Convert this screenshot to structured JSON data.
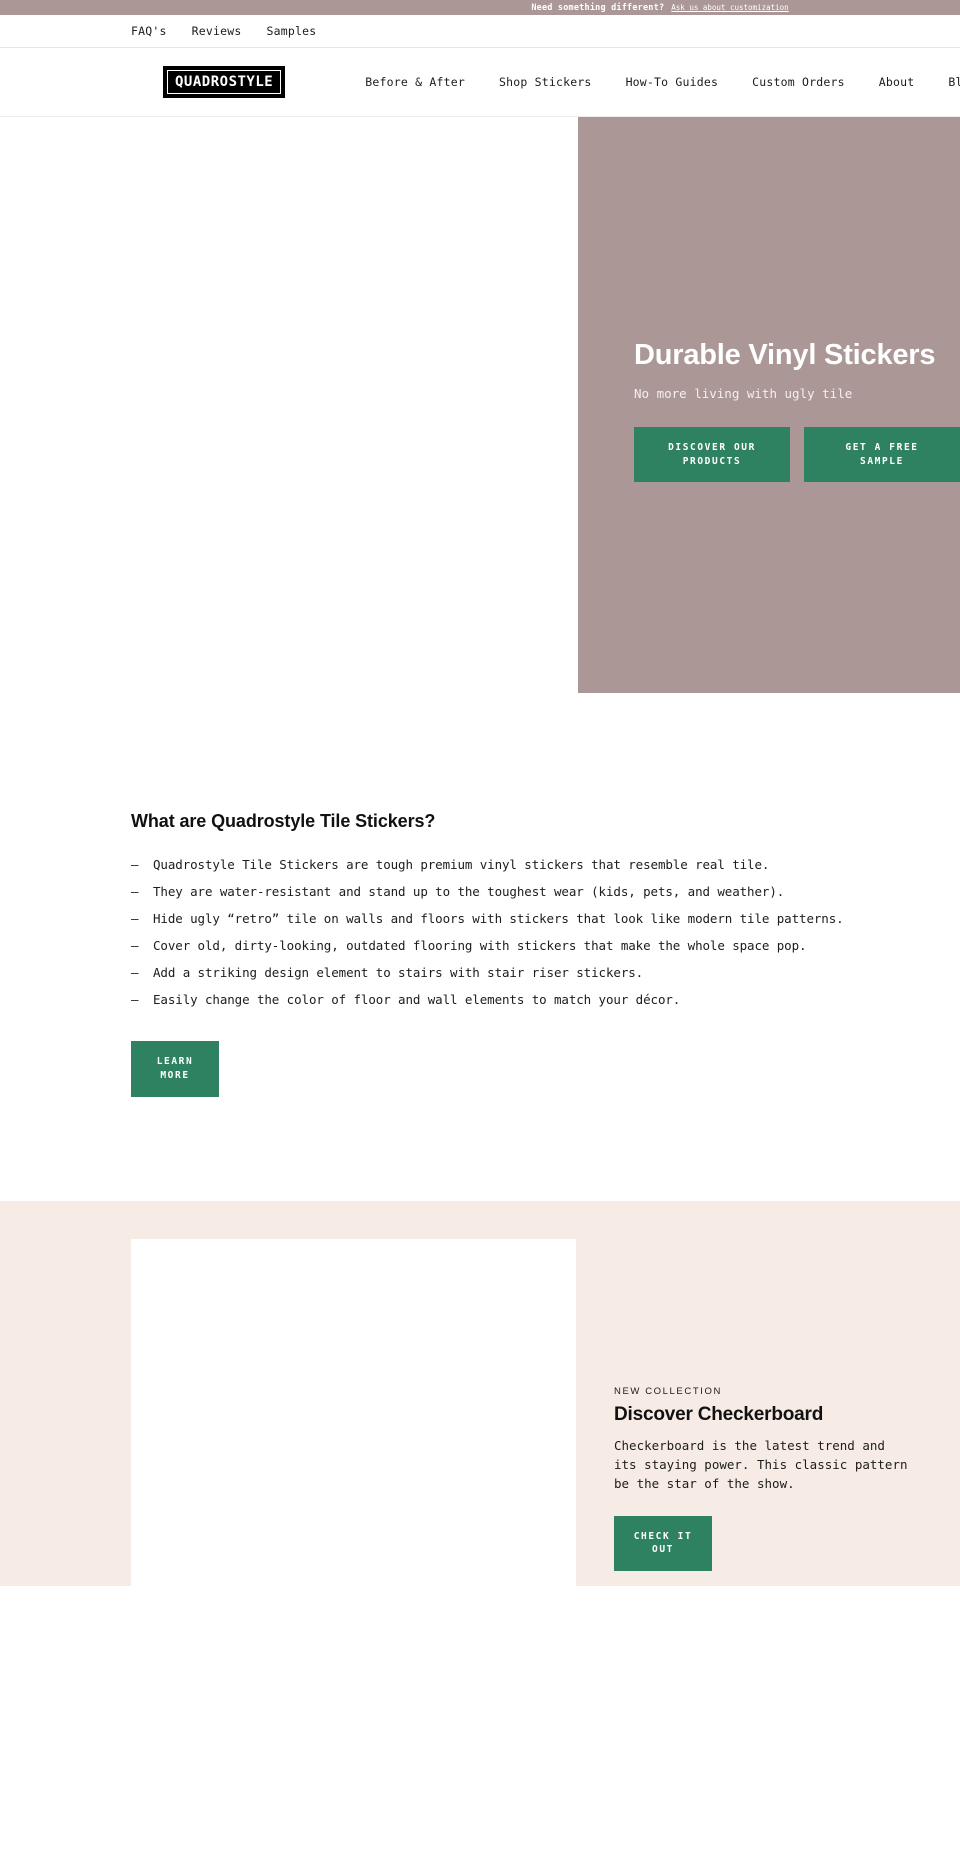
{
  "announcement": {
    "text": "Need something different?",
    "link_label": "Ask us about customization"
  },
  "utility_nav": {
    "items": [
      {
        "label": "FAQ's"
      },
      {
        "label": "Reviews"
      },
      {
        "label": "Samples"
      }
    ]
  },
  "header": {
    "logo_text": "QUADROSTYLE",
    "nav": [
      {
        "label": "Before & After"
      },
      {
        "label": "Shop Stickers"
      },
      {
        "label": "How-To Guides"
      },
      {
        "label": "Custom Orders"
      },
      {
        "label": "About"
      },
      {
        "label": "Blog"
      }
    ]
  },
  "hero": {
    "title": "Durable Vinyl Stickers",
    "subtitle": "No more living with ugly tile",
    "primary_button": "DISCOVER OUR\nPRODUCTS",
    "secondary_button": "GET A FREE\nSAMPLE",
    "background_color": "#ab9896"
  },
  "about": {
    "title": "What are Quadrostyle Tile Stickers?",
    "bullet_marker": "—",
    "bullets": [
      "Quadrostyle Tile Stickers are tough premium vinyl stickers that resemble real tile.",
      "They are water-resistant and stand up to the toughest wear (kids, pets, and weather).",
      "Hide ugly “retro” tile on walls and floors with stickers that look like modern tile patterns.",
      "Cover old, dirty-looking, outdated flooring with stickers that make the whole space pop.",
      "Add a striking design element to stairs with stair riser stickers.",
      "Easily change the color of floor and wall elements to match your décor."
    ],
    "button": "LEARN\nMORE"
  },
  "collection": {
    "eyebrow": "NEW COLLECTION",
    "title": "Discover Checkerboard",
    "body": "Checkerboard is the latest trend and\nits staying power. This classic pattern\nbe the star of the show.",
    "button": "CHECK IT\nOUT",
    "background_color": "#f7ece5"
  },
  "theme": {
    "accent_green": "#2e8262",
    "mauve": "#ab9896",
    "beige": "#f7ece5"
  }
}
